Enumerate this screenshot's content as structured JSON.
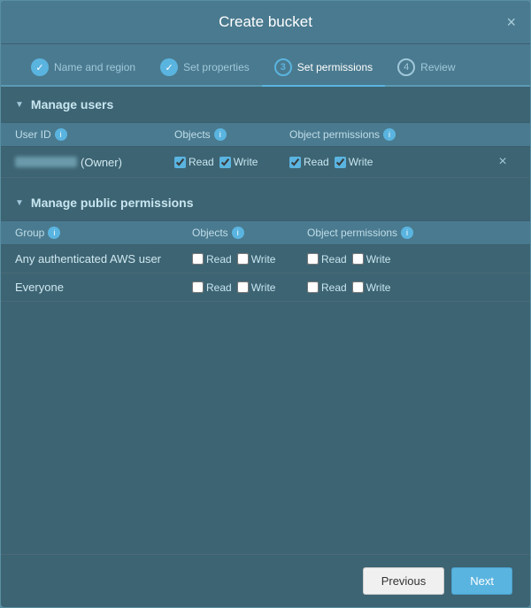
{
  "modal": {
    "title": "Create bucket",
    "close_label": "×"
  },
  "wizard": {
    "steps": [
      {
        "id": "name-region",
        "label": "Name and region",
        "state": "completed",
        "number": "✓"
      },
      {
        "id": "set-properties",
        "label": "Set properties",
        "state": "completed",
        "number": "✓"
      },
      {
        "id": "set-permissions",
        "label": "Set permissions",
        "state": "active",
        "number": "3"
      },
      {
        "id": "review",
        "label": "Review",
        "state": "pending",
        "number": "4"
      }
    ]
  },
  "manage_users": {
    "section_label": "Manage users",
    "table_headers": {
      "user_id": "User ID",
      "objects": "Objects",
      "object_permissions": "Object permissions"
    },
    "rows": [
      {
        "user_id_blurred": true,
        "owner_label": "(Owner)",
        "objects_read": true,
        "objects_write": true,
        "permissions_read": true,
        "permissions_write": true
      }
    ]
  },
  "manage_public": {
    "section_label": "Manage public permissions",
    "table_headers": {
      "group": "Group",
      "objects": "Objects",
      "object_permissions": "Object permissions"
    },
    "rows": [
      {
        "group": "Any authenticated AWS user",
        "objects_read": false,
        "objects_write": false,
        "permissions_read": false,
        "permissions_write": false
      },
      {
        "group": "Everyone",
        "objects_read": false,
        "objects_write": false,
        "permissions_read": false,
        "permissions_write": false
      }
    ]
  },
  "footer": {
    "previous_label": "Previous",
    "next_label": "Next"
  },
  "labels": {
    "read": "Read",
    "write": "Write"
  }
}
